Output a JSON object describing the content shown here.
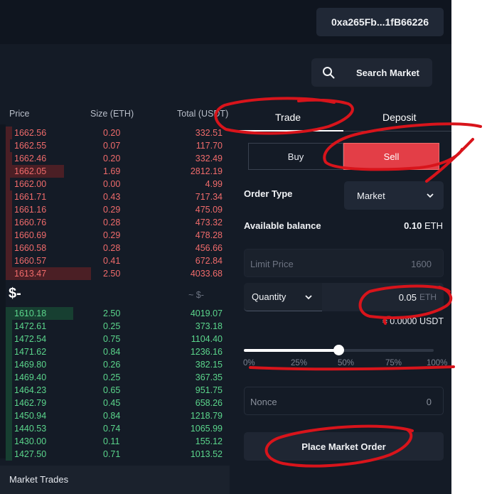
{
  "wallet": {
    "address": "0xa265Fb...1fB66226"
  },
  "search": {
    "label": "Search Market"
  },
  "order_book": {
    "headers": {
      "price": "Price",
      "size": "Size (ETH)",
      "total": "Total (USDT)"
    },
    "asks": [
      {
        "price": "1662.56",
        "size": "0.20",
        "total": "332.51",
        "depth": 0.03
      },
      {
        "price": "1662.55",
        "size": "0.07",
        "total": "117.70",
        "depth": 0.02
      },
      {
        "price": "1662.46",
        "size": "0.20",
        "total": "332.49",
        "depth": 0.03
      },
      {
        "price": "1662.05",
        "size": "1.69",
        "total": "2812.19",
        "depth": 0.26
      },
      {
        "price": "1662.00",
        "size": "0.00",
        "total": "4.99",
        "depth": 0.02
      },
      {
        "price": "1661.71",
        "size": "0.43",
        "total": "717.34",
        "depth": 0.03
      },
      {
        "price": "1661.16",
        "size": "0.29",
        "total": "475.09",
        "depth": 0.03
      },
      {
        "price": "1660.76",
        "size": "0.28",
        "total": "473.32",
        "depth": 0.03
      },
      {
        "price": "1660.69",
        "size": "0.29",
        "total": "478.28",
        "depth": 0.03
      },
      {
        "price": "1660.58",
        "size": "0.28",
        "total": "456.66",
        "depth": 0.03
      },
      {
        "price": "1660.57",
        "size": "0.41",
        "total": "672.84",
        "depth": 0.03
      },
      {
        "price": "1613.47",
        "size": "2.50",
        "total": "4033.68",
        "depth": 0.38
      }
    ],
    "mid_price": "$-",
    "mid_price_secondary": "~ $-",
    "bids": [
      {
        "price": "1610.18",
        "size": "2.50",
        "total": "4019.07",
        "depth": 0.3
      },
      {
        "price": "1472.61",
        "size": "0.25",
        "total": "373.18",
        "depth": 0.03
      },
      {
        "price": "1472.54",
        "size": "0.75",
        "total": "1104.40",
        "depth": 0.03
      },
      {
        "price": "1471.62",
        "size": "0.84",
        "total": "1236.16",
        "depth": 0.03
      },
      {
        "price": "1469.80",
        "size": "0.26",
        "total": "382.15",
        "depth": 0.03
      },
      {
        "price": "1469.40",
        "size": "0.25",
        "total": "367.35",
        "depth": 0.03
      },
      {
        "price": "1464.23",
        "size": "0.65",
        "total": "951.75",
        "depth": 0.03
      },
      {
        "price": "1462.79",
        "size": "0.45",
        "total": "658.26",
        "depth": 0.03
      },
      {
        "price": "1450.94",
        "size": "0.84",
        "total": "1218.79",
        "depth": 0.03
      },
      {
        "price": "1440.53",
        "size": "0.74",
        "total": "1065.99",
        "depth": 0.03
      },
      {
        "price": "1430.00",
        "size": "0.11",
        "total": "155.12",
        "depth": 0.03
      },
      {
        "price": "1427.50",
        "size": "0.71",
        "total": "1013.52",
        "depth": 0.03
      }
    ]
  },
  "market_trades": {
    "label": "Market Trades"
  },
  "panel": {
    "tabs": {
      "trade": "Trade",
      "deposit": "Deposit"
    },
    "side": {
      "buy": "Buy",
      "sell": "Sell"
    },
    "order_type": {
      "label": "Order Type",
      "value": "Market"
    },
    "balance": {
      "label": "Available balance",
      "amount": "0.10",
      "unit": "ETH"
    },
    "limit_price": {
      "placeholder": "Limit Price",
      "value": "1600"
    },
    "quantity": {
      "mode": "Quantity",
      "value": "0.05",
      "unit": "ETH"
    },
    "usdt_estimate": "≈ 0.0000 USDT",
    "slider": {
      "percent": 50,
      "marks": [
        "0%",
        "25%",
        "50%",
        "75%",
        "100%"
      ]
    },
    "nonce": {
      "placeholder": "Nonce",
      "value": "0"
    },
    "place_button": "Place Market Order"
  },
  "colors": {
    "ask": "#f06b6b",
    "bid": "#5bd68c",
    "sell_button": "#e33e47",
    "annotation": "#d8141b"
  }
}
